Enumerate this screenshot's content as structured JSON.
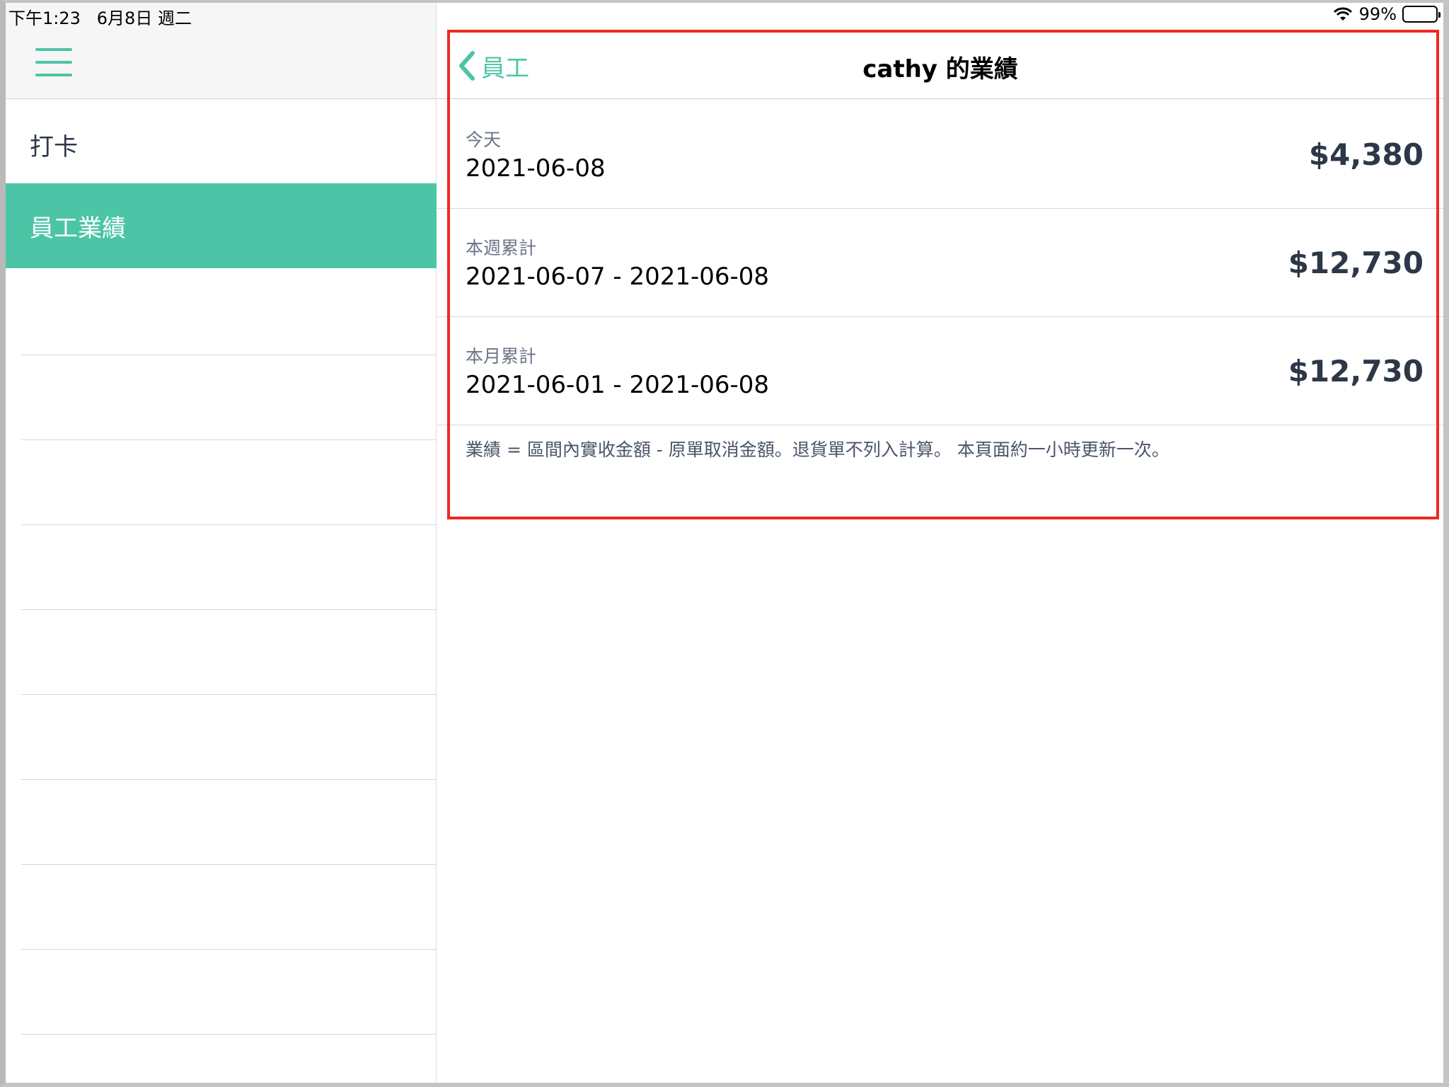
{
  "status_bar": {
    "time_date": "下午1:23   6月8日 週二",
    "battery": "99%"
  },
  "sidebar": {
    "items": [
      {
        "label": "打卡"
      },
      {
        "label": "員工業績"
      }
    ]
  },
  "detail": {
    "back_label": "員工",
    "title": "cathy 的業績",
    "rows": [
      {
        "label": "今天",
        "date": "2021-06-08",
        "amount": "$4,380"
      },
      {
        "label": "本週累計",
        "date": "2021-06-07 - 2021-06-08",
        "amount": "$12,730"
      },
      {
        "label": "本月累計",
        "date": "2021-06-01 - 2021-06-08",
        "amount": "$12,730"
      }
    ],
    "footnote": "業績 = 區間內實收金額 - 原單取消金額。退貨單不列入計算。 本頁面約一小時更新一次。"
  },
  "icons": {
    "menu": "hamburger-menu-icon",
    "back": "chevron-left-icon",
    "wifi": "wifi-icon",
    "battery": "battery-icon"
  },
  "colors": {
    "accent": "#4cc5a6",
    "highlight": "#ee2a1f"
  }
}
